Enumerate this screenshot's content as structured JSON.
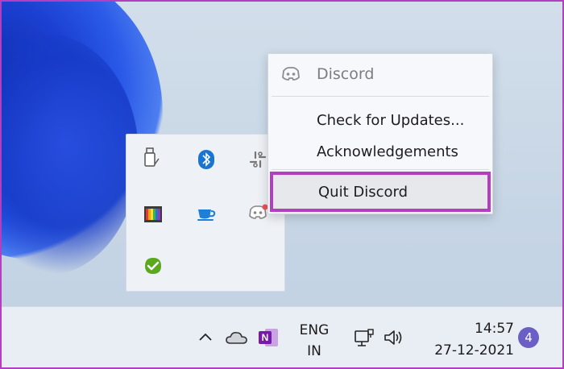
{
  "context_menu": {
    "app_name": "Discord",
    "items": [
      {
        "label": "Check for Updates..."
      },
      {
        "label": "Acknowledgements"
      }
    ],
    "quit_label": "Quit Discord"
  },
  "tray": {
    "icons": [
      "usb-drive-icon",
      "bluetooth-icon",
      "slack-icon",
      "color-palette-app-icon",
      "coffee-cup-icon",
      "discord-icon",
      "green-check-icon"
    ]
  },
  "taskbar": {
    "language_line1": "ENG",
    "language_line2": "IN",
    "time": "14:57",
    "date": "27-12-2021",
    "notification_count": "4"
  },
  "colors": {
    "highlight": "#b13fc0",
    "notification_badge": "#6b5ec4",
    "onenote": "#7719aa"
  }
}
